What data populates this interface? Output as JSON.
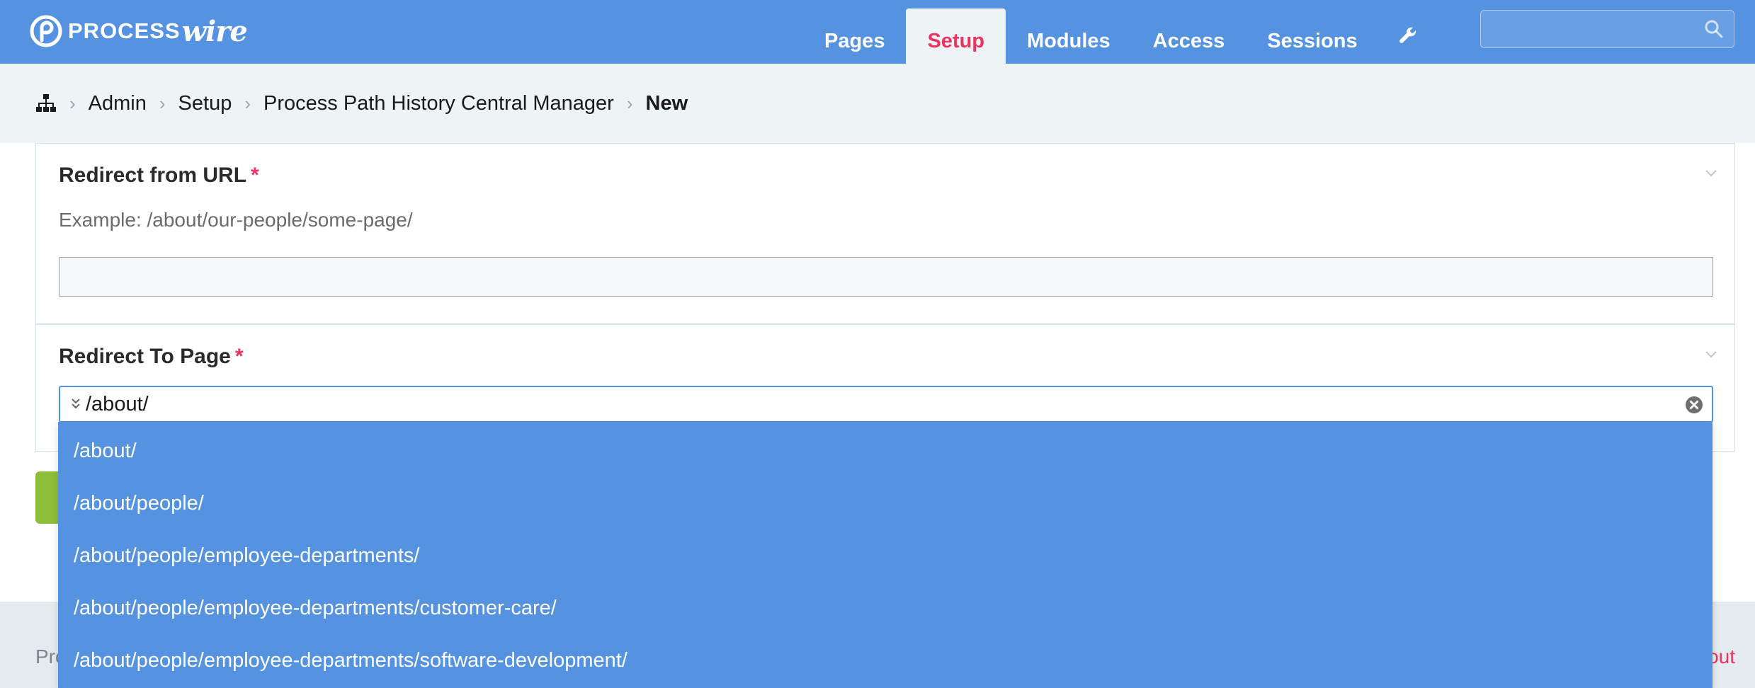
{
  "header": {
    "logo_text_1": "PROCESS",
    "logo_text_2": "wire",
    "nav": [
      {
        "label": "Pages"
      },
      {
        "label": "Setup"
      },
      {
        "label": "Modules"
      },
      {
        "label": "Access"
      },
      {
        "label": "Sessions"
      }
    ],
    "active_tab": "Setup",
    "wrench_icon": "wrench-icon",
    "search_placeholder": "",
    "colors": {
      "bar": "#5593e0",
      "active_text": "#e83561"
    }
  },
  "breadcrumb": {
    "home_icon": "sitemap-icon",
    "items": [
      "Admin",
      "Setup",
      "Process Path History Central Manager"
    ],
    "current": "New"
  },
  "form": {
    "redirect_from": {
      "label": "Redirect from URL",
      "required_mark": "*",
      "description": "Example: /about/our-people/some-page/",
      "value": ""
    },
    "redirect_to": {
      "label": "Redirect To Page",
      "required_mark": "*",
      "value": "/about/",
      "options": [
        "/about/",
        "/about/people/",
        "/about/people/employee-departments/",
        "/about/people/employee-departments/customer-care/",
        "/about/people/employee-departments/software-development/"
      ]
    }
  },
  "footer": {
    "left_text": "Pro",
    "right_text": "out"
  }
}
